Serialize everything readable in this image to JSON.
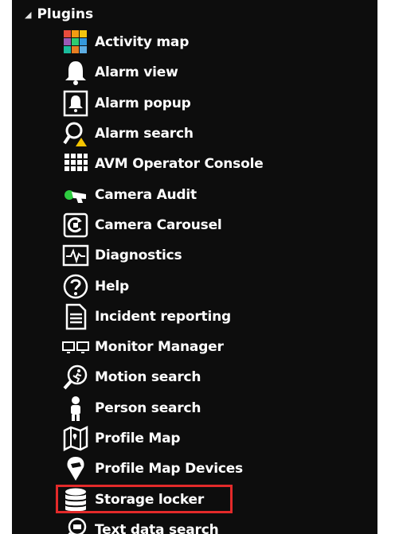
{
  "tree": {
    "header": {
      "label": "Plugins",
      "expanded": true
    },
    "items": [
      {
        "label": "Activity map",
        "icon": "activity-map-icon"
      },
      {
        "label": "Alarm view",
        "icon": "bell-icon"
      },
      {
        "label": "Alarm popup",
        "icon": "alarm-popup-icon"
      },
      {
        "label": "Alarm search",
        "icon": "alarm-search-icon"
      },
      {
        "label": "AVM Operator Console",
        "icon": "grid-console-icon"
      },
      {
        "label": "Camera Audit",
        "icon": "camera-audit-icon"
      },
      {
        "label": "Camera Carousel",
        "icon": "camera-carousel-icon"
      },
      {
        "label": "Diagnostics",
        "icon": "diagnostics-icon"
      },
      {
        "label": "Help",
        "icon": "help-icon"
      },
      {
        "label": "Incident reporting",
        "icon": "document-icon"
      },
      {
        "label": "Monitor Manager",
        "icon": "monitors-icon"
      },
      {
        "label": "Motion search",
        "icon": "motion-search-icon"
      },
      {
        "label": "Person search",
        "icon": "person-icon"
      },
      {
        "label": "Profile Map",
        "icon": "map-icon"
      },
      {
        "label": "Profile Map Devices",
        "icon": "map-devices-icon"
      },
      {
        "label": "Storage locker",
        "icon": "database-icon",
        "highlighted": true
      },
      {
        "label": "Text data search",
        "icon": "text-search-icon"
      }
    ]
  },
  "colors": {
    "background": "#0d0d0d",
    "text": "#ffffff",
    "highlight": "#e32a2a"
  }
}
